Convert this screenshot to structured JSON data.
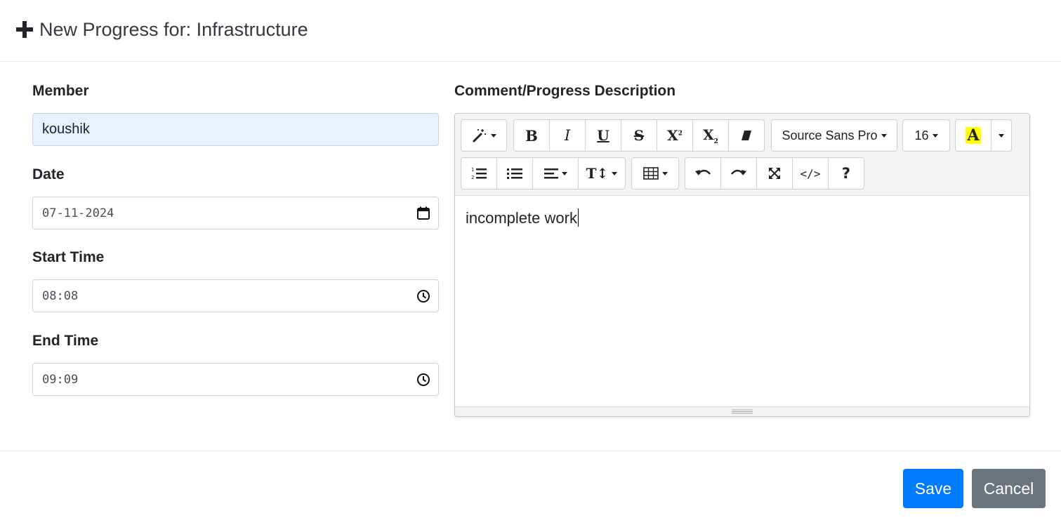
{
  "header": {
    "title": "New Progress for: Infrastructure",
    "icon": "plus-icon"
  },
  "form": {
    "member": {
      "label": "Member",
      "value": "koushik"
    },
    "date": {
      "label": "Date",
      "value": "07-11-2024",
      "icon": "calendar-icon"
    },
    "start_time": {
      "label": "Start Time",
      "value": "08:08",
      "icon": "clock-icon"
    },
    "end_time": {
      "label": "End Time",
      "value": "09:09",
      "icon": "clock-icon"
    }
  },
  "editor": {
    "label": "Comment/Progress Description",
    "font_name": "Source Sans Pro",
    "font_size": "16",
    "content": "incomplete work",
    "highlight_color": "#ffff00",
    "toolbar_icons": [
      "magic-icon",
      "bold-icon",
      "italic-icon",
      "underline-icon",
      "strikethrough-icon",
      "superscript-icon",
      "subscript-icon",
      "eraser-icon",
      "ordered-list-icon",
      "unordered-list-icon",
      "align-icon",
      "line-height-icon",
      "table-icon",
      "undo-icon",
      "redo-icon",
      "fullscreen-icon",
      "code-view-icon",
      "help-icon"
    ]
  },
  "footer": {
    "save_label": "Save",
    "cancel_label": "Cancel"
  },
  "colors": {
    "primary": "#007bff",
    "secondary": "#6c757d",
    "member_bg": "#e8f0fe"
  }
}
